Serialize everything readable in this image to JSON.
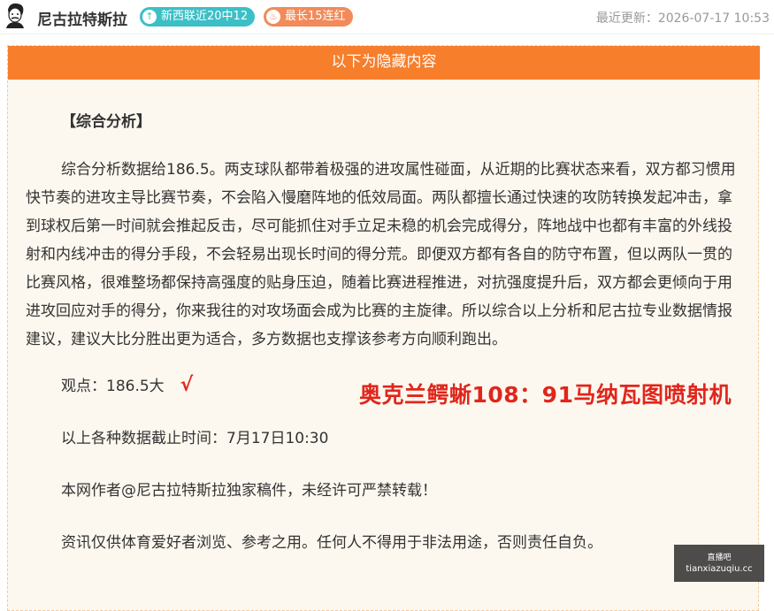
{
  "header": {
    "author_name": "尼古拉特斯拉",
    "badges": [
      {
        "label": "新西联近20中12",
        "icon": "arrow-up-icon",
        "color": "#3cbfc7"
      },
      {
        "label": "最长15连红",
        "icon": "flame-icon",
        "color": "#f28a5a"
      }
    ],
    "updated_text": "最近更新：2026-07-17 10:53"
  },
  "hidden_bar": {
    "label": "以下为隐藏内容",
    "color": "#f77e2b"
  },
  "article": {
    "heading": "【综合分析】",
    "paragraph": "综合分析数据给186.5。两支球队都带着极强的进攻属性碰面，从近期的比赛状态来看，双方都习惯用快节奏的进攻主导比赛节奏，不会陷入慢磨阵地的低效局面。两队都擅长通过快速的攻防转换发起冲击，拿到球权后第一时间就会推起反击，尽可能抓住对手立足未稳的机会完成得分，阵地战中也都有丰富的外线投射和内线冲击的得分手段，不会轻易出现长时间的得分荒。即便双方都有各自的防守布置，但以两队一贯的比赛风格，很难整场都保持高强度的贴身压迫，随着比赛进程推进，对抗强度提升后，双方都会更倾向于用进攻回应对手的得分，你来我往的对攻场面会成为比赛的主旋律。所以综合以上分析和尼古拉专业数据情报建议，建议大比分胜出更为适合，多方数据也支撑该参考方向顺利跑出。",
    "viewpoint": "观点：186.5大",
    "check_mark": "√",
    "data_time": "以上各种数据截止时间：7月17日10:30",
    "copyright": "本网作者@尼古拉特斯拉独家稿件，未经许可严禁转载！",
    "disclaimer": "资讯仅供体育爱好者浏览、参考之用。任何人不得用于非法用途，否则责任自负。"
  },
  "overlay_result": "奥克兰鳄蜥108：91马纳瓦图喷射机",
  "watermark": {
    "line1": "直播吧",
    "line2": "tianxiazuqiu.cc"
  }
}
